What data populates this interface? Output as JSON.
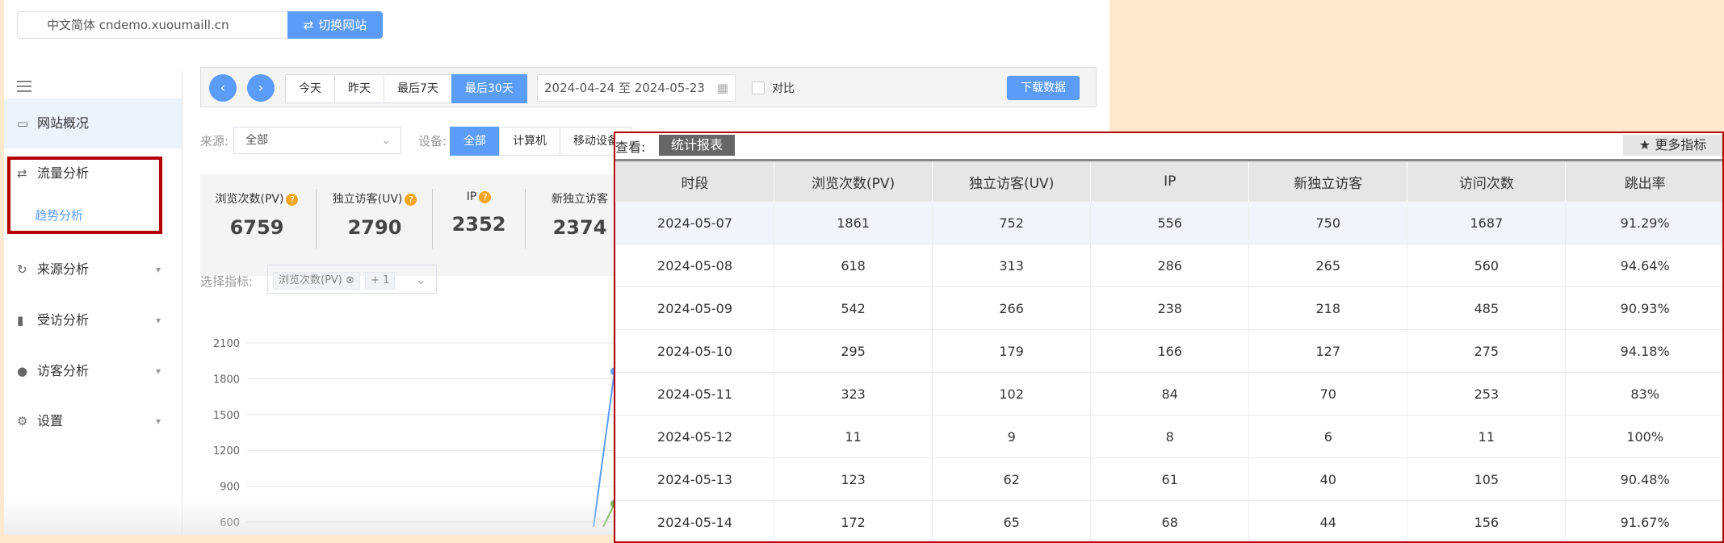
{
  "topbar": {
    "site_value": "中文简体 cndemo.xuoumaill.cn",
    "switch_label": "切换网站",
    "switch_icon": "swap-icon"
  },
  "sidebar": {
    "items": [
      {
        "label": "网站概况",
        "icon": "monitor-icon"
      },
      {
        "label": "流量分析",
        "icon": "swap-icon"
      },
      {
        "label": "趋势分析"
      },
      {
        "label": "来源分析",
        "icon": "refresh-icon"
      },
      {
        "label": "受访分析",
        "icon": "bar-chart-icon"
      },
      {
        "label": "访客分析",
        "icon": "users-icon"
      },
      {
        "label": "设置",
        "icon": "gear-icon"
      }
    ]
  },
  "toolbar": {
    "ranges": [
      "今天",
      "昨天",
      "最后7天",
      "最后30天"
    ],
    "active_range": "最后30天",
    "date_range": "2024-04-24 至 2024-05-23",
    "compare_label": "对比",
    "download_label": "下载数据"
  },
  "filters": {
    "source_label": "来源:",
    "source_value": "全部",
    "device_label": "设备:",
    "devices": [
      "全部",
      "计算机",
      "移动设备"
    ],
    "active_device": "全部"
  },
  "stats": [
    {
      "label": "浏览次数(PV)",
      "value": "6759"
    },
    {
      "label": "独立访客(UV)",
      "value": "2790"
    },
    {
      "label": "IP",
      "value": "2352"
    },
    {
      "label": "新独立访客",
      "value": "2374"
    }
  ],
  "metric_select": {
    "label": "选择指标:",
    "tag": "浏览次数(PV)",
    "more": "+ 1"
  },
  "chart_data": {
    "type": "line",
    "y_ticks": [
      2100,
      1800,
      1500,
      1200,
      900,
      600
    ],
    "ylim": [
      600,
      2100
    ],
    "series": [
      {
        "color": "#5a9cf8",
        "peak_value": 1861
      },
      {
        "color": "#6ab04c",
        "peak_value": 752
      }
    ]
  },
  "panel": {
    "view_label": "查看:",
    "tab_label": "统计报表",
    "more_label": "★ 更多指标",
    "columns": [
      "时段",
      "浏览次数(PV)",
      "独立访客(UV)",
      "IP",
      "新独立访客",
      "访问次数",
      "跳出率"
    ],
    "rows": [
      [
        "2024-05-07",
        "1861",
        "752",
        "556",
        "750",
        "1687",
        "91.29%"
      ],
      [
        "2024-05-08",
        "618",
        "313",
        "286",
        "265",
        "560",
        "94.64%"
      ],
      [
        "2024-05-09",
        "542",
        "266",
        "238",
        "218",
        "485",
        "90.93%"
      ],
      [
        "2024-05-10",
        "295",
        "179",
        "166",
        "127",
        "275",
        "94.18%"
      ],
      [
        "2024-05-11",
        "323",
        "102",
        "84",
        "70",
        "253",
        "83%"
      ],
      [
        "2024-05-12",
        "11",
        "9",
        "8",
        "6",
        "11",
        "100%"
      ],
      [
        "2024-05-13",
        "123",
        "62",
        "61",
        "40",
        "105",
        "90.48%"
      ],
      [
        "2024-05-14",
        "172",
        "65",
        "68",
        "44",
        "156",
        "91.67%"
      ]
    ]
  }
}
